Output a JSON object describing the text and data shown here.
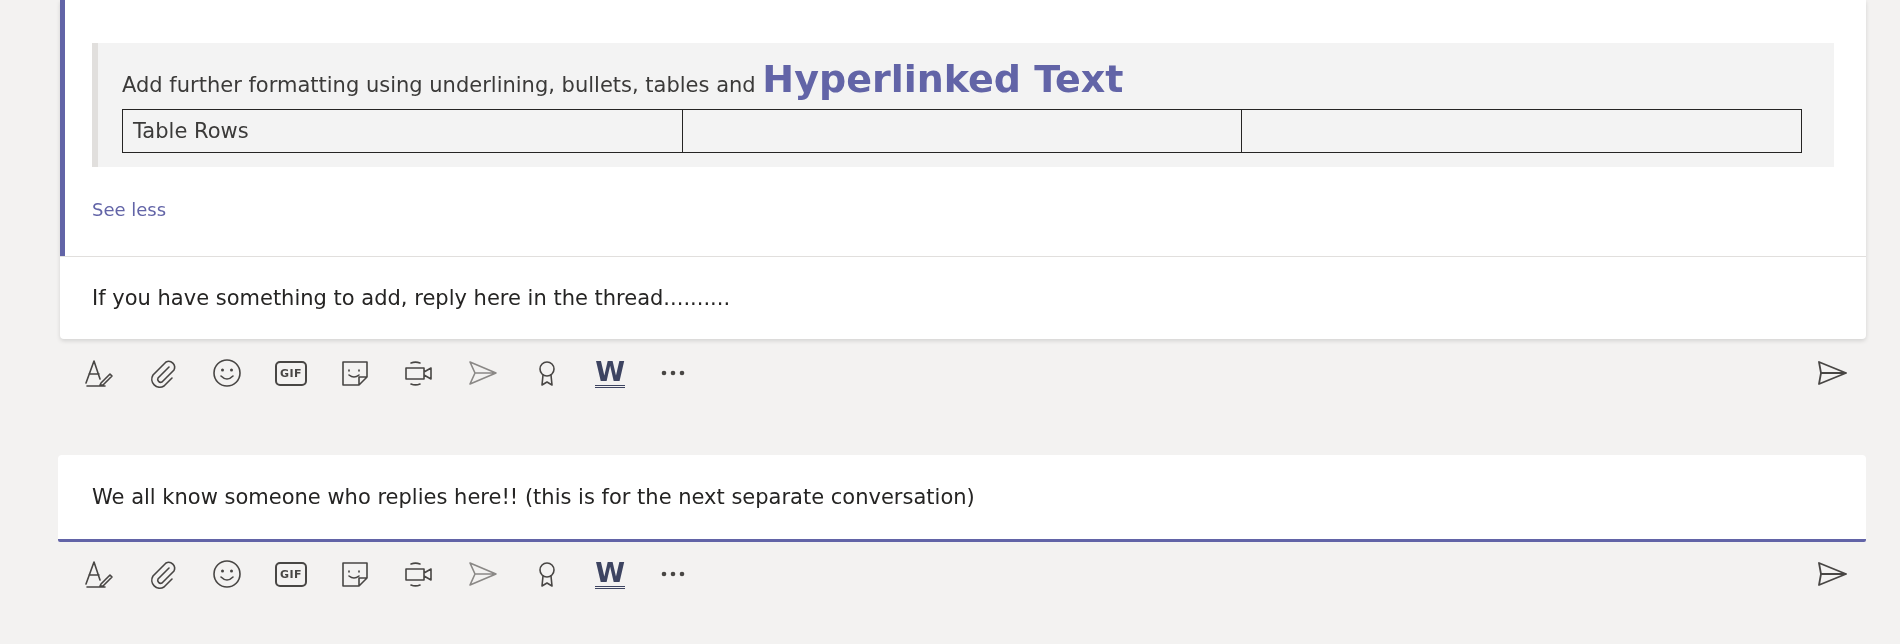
{
  "post": {
    "quote": {
      "text": "Add further formatting using underlining, bullets, tables and",
      "link": "Hyperlinked Text",
      "table_rows": [
        [
          "Table Rows",
          "",
          ""
        ]
      ]
    },
    "see_less": "See less",
    "reply": "If you have something to add, reply here in the thread.........."
  },
  "reply_toolbar": {
    "items": [
      {
        "kind": "format"
      },
      {
        "kind": "attach"
      },
      {
        "kind": "emoji"
      },
      {
        "kind": "gif",
        "label": "GIF"
      },
      {
        "kind": "sticker"
      },
      {
        "kind": "meet"
      },
      {
        "kind": "plane"
      },
      {
        "kind": "ribbon"
      },
      {
        "kind": "app",
        "label": "W"
      },
      {
        "kind": "more"
      }
    ]
  },
  "new_conversation": {
    "value": "We all know someone who replies here!! (this is for the next separate conversation)",
    "focused": true
  },
  "compose_toolbar": {
    "items": [
      {
        "kind": "format"
      },
      {
        "kind": "attach"
      },
      {
        "kind": "emoji"
      },
      {
        "kind": "gif",
        "label": "GIF"
      },
      {
        "kind": "sticker"
      },
      {
        "kind": "meet"
      },
      {
        "kind": "plane"
      },
      {
        "kind": "ribbon"
      },
      {
        "kind": "app",
        "label": "W"
      },
      {
        "kind": "more"
      }
    ]
  }
}
